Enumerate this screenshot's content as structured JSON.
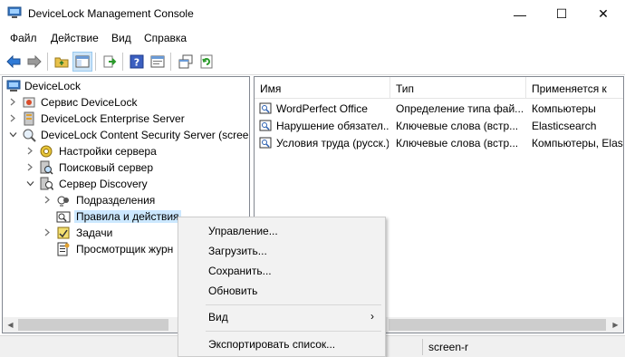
{
  "window": {
    "title": "DeviceLock Management Console",
    "minimize_glyph": "—",
    "maximize_glyph": "☐",
    "close_glyph": "✕"
  },
  "menu": [
    "Файл",
    "Действие",
    "Вид",
    "Справка"
  ],
  "toolbar": {
    "icons": [
      "back-arrow-icon",
      "forward-arrow-icon",
      "folder-up-icon",
      "show-tree-icon",
      "export-icon",
      "help-icon",
      "properties-icon",
      "new-window-icon",
      "refresh-icon"
    ]
  },
  "tree": {
    "items": [
      {
        "label": "DeviceLock",
        "icon": "computer-icon",
        "expanded": true
      },
      {
        "label": "Сервис DeviceLock",
        "icon": "service-icon",
        "expanded": false
      },
      {
        "label": "DeviceLock Enterprise Server",
        "icon": "enterprise-server-icon",
        "expanded": false
      },
      {
        "label": "DeviceLock Content Security Server (screen",
        "icon": "content-security-icon",
        "expanded": true
      },
      {
        "label": "Настройки сервера",
        "icon": "settings-gear-icon",
        "expanded": false
      },
      {
        "label": "Поисковый сервер",
        "icon": "search-server-icon",
        "expanded": false
      },
      {
        "label": "Сервер Discovery",
        "icon": "discovery-icon",
        "expanded": true
      },
      {
        "label": "Подразделения",
        "icon": "units-icon",
        "expanded": false
      },
      {
        "label": "Правила и действия",
        "icon": "rules-icon",
        "expanded": false,
        "selected": true
      },
      {
        "label": "Задачи",
        "icon": "tasks-icon",
        "expanded": false
      },
      {
        "label": "Просмотрщик журн",
        "icon": "log-viewer-icon",
        "expanded": false
      }
    ]
  },
  "list": {
    "columns": [
      "Имя",
      "Тип",
      "Применяется к"
    ],
    "rows": [
      {
        "name": "WordPerfect Office",
        "type": "Определение типа фай...",
        "applies": "Компьютеры"
      },
      {
        "name": "Нарушение обязател...",
        "type": "Ключевые слова (встр...",
        "applies": "Elasticsearch"
      },
      {
        "name": "Условия труда (русск.)",
        "type": "Ключевые слова (встр...",
        "applies": "Компьютеры, Elast"
      }
    ]
  },
  "status": {
    "segment_text": "screen-r"
  },
  "context_menu": {
    "items": [
      "Управление...",
      "Загрузить...",
      "Сохранить...",
      "Обновить",
      "Вид",
      "Экспортировать список..."
    ],
    "submenu_glyph": "›"
  }
}
